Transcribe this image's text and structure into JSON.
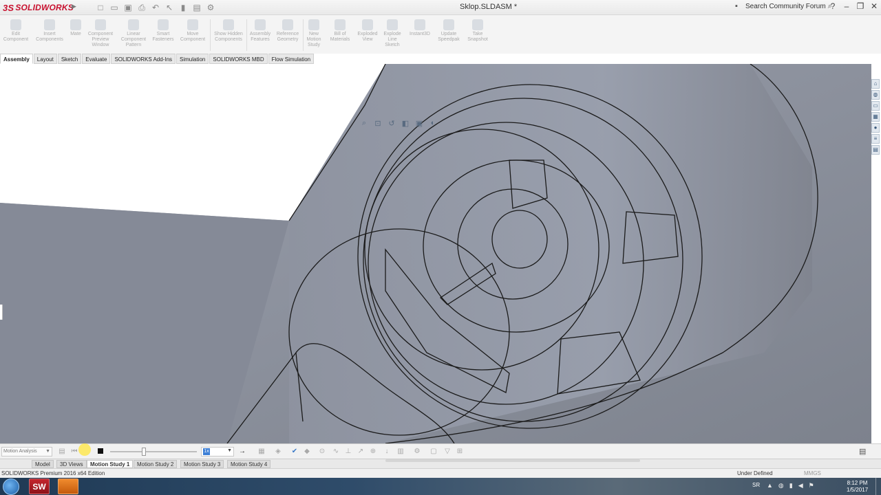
{
  "app": {
    "logo_mark": "3S",
    "logo_text": "SOLIDWORKS",
    "document_title": "Sklop.SLDASM *",
    "search_placeholder": "Search Community Forum"
  },
  "command_manager": [
    {
      "name": "edit-component-button",
      "label": "Edit Component"
    },
    {
      "name": "insert-components-button",
      "label": "Insert Components"
    },
    {
      "name": "mate-button",
      "label": "Mate"
    },
    {
      "name": "component-preview-window-button",
      "label": "Component Preview Window"
    },
    {
      "name": "linear-component-pattern-button",
      "label": "Linear Component Pattern"
    },
    {
      "name": "smart-fasteners-button",
      "label": "Smart Fasteners"
    },
    {
      "name": "move-component-button",
      "label": "Move Component"
    },
    {
      "name": "show-hidden-components-button",
      "label": "Show Hidden Components"
    },
    {
      "name": "assembly-features-button",
      "label": "Assembly Features"
    },
    {
      "name": "reference-geometry-button",
      "label": "Reference Geometry"
    },
    {
      "name": "new-motion-study-button",
      "label": "New Motion Study"
    },
    {
      "name": "bill-of-materials-button",
      "label": "Bill of Materials"
    },
    {
      "name": "exploded-view-button",
      "label": "Exploded View"
    },
    {
      "name": "explode-line-sketch-button",
      "label": "Explode Line Sketch"
    },
    {
      "name": "instant3d-button",
      "label": "Instant3D"
    },
    {
      "name": "update-speedpak-button",
      "label": "Update Speedpak"
    },
    {
      "name": "take-snapshot-button",
      "label": "Take Snapshot"
    }
  ],
  "tabs": [
    "Assembly",
    "Layout",
    "Sketch",
    "Evaluate",
    "SOLIDWORKS Add-Ins",
    "Simulation",
    "SOLIDWORKS MBD",
    "Flow Simulation"
  ],
  "motion": {
    "study_type": "Motion Analysis",
    "speed_value": "1x"
  },
  "study_tabs": [
    "Model",
    "3D Views",
    "Motion Study 1",
    "Motion Study 2",
    "Motion Study 3",
    "Motion Study 4"
  ],
  "status": {
    "edition": "SOLIDWORKS Premium 2016 x64 Edition",
    "state": "Under Defined",
    "units": "MMGS"
  },
  "taskbar": {
    "sw_badge": "SW",
    "language": "SR",
    "time": "8:12 PM",
    "date": "1/5/2017"
  },
  "colors": {
    "brand": "#c8102e",
    "model_fill": "#8a8f9c",
    "model_edge": "#1a1a1a"
  }
}
